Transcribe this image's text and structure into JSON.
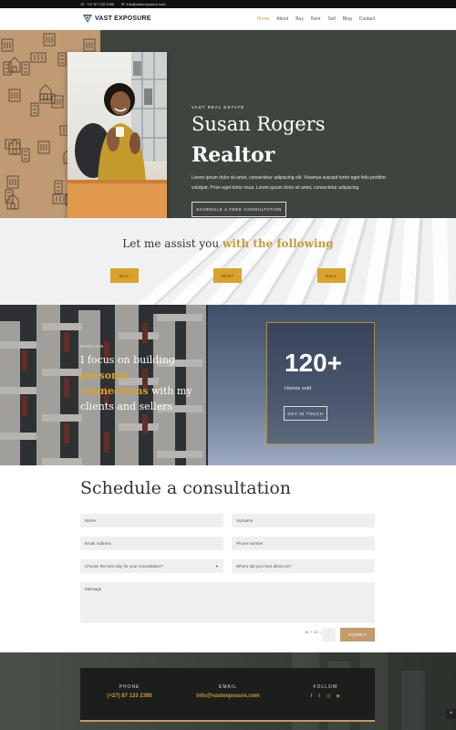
{
  "topbar": {
    "phone": "+27 87 133 2398",
    "email": "info@vastexposure.com"
  },
  "header": {
    "logo_text": "VAST EXPOSURE",
    "nav": [
      "Home",
      "About",
      "Buy",
      "Rent",
      "Sell",
      "Blog",
      "Contact"
    ],
    "active_nav": "Home"
  },
  "hero": {
    "kicker": "VAST REAL ESTATE",
    "name": "Susan Rogers",
    "role": "Realtor",
    "body": "Lorem ipsum dolor sit amet, consectetur adipiscing elit. Vivamus suscipit tortor eget felis porttitor volutpat. Proin eget tortor risus. Lorem ipsum dolor sit amet, consectetur adipiscing",
    "cta": "SCHEDULE A FREE CONSULTATION"
  },
  "assist": {
    "title_plain": "Let me assist you",
    "title_gold": "with the following",
    "buttons": [
      "BUY",
      "RENT",
      "SELL"
    ]
  },
  "mission": {
    "kicker": "MISSION",
    "text_1": "I focus on building",
    "text_gold": "personal connections",
    "text_2": "with my clients and sellers",
    "stat_number": "120+",
    "stat_label": "Homes sold",
    "cta": "GET IN TOUCH"
  },
  "schedule": {
    "title": "Schedule a consultation",
    "fields": {
      "name": "Name",
      "surname": "Surname",
      "email": "Email Address",
      "phone": "Phone number",
      "day_select": "Choose the best day for your consultation?",
      "hear": "Where did you hear about us?",
      "message": "Message"
    },
    "captcha": "11 + 14 =",
    "submit": "SUBMIT"
  },
  "footer": {
    "phone_head": "PHONE",
    "phone_value": "(+27) 87 133 2398",
    "email_head": "EMAIL",
    "email_value": "info@vastexposure.com",
    "follow_head": "FOLLOW",
    "social": [
      "f",
      "t",
      "ig",
      "yt"
    ]
  },
  "colors": {
    "gold": "#c99a3a",
    "hero_bg": "#3e453e",
    "pattern_bg": "#bf9a73",
    "button_gold": "#d9a22c",
    "submit": "#c29a6c"
  },
  "icons": [
    "phone-icon",
    "mail-icon",
    "logo-mark",
    "chevron-down-icon",
    "facebook-icon",
    "twitter-icon",
    "instagram-icon",
    "youtube-icon",
    "arrow-up-icon"
  ]
}
